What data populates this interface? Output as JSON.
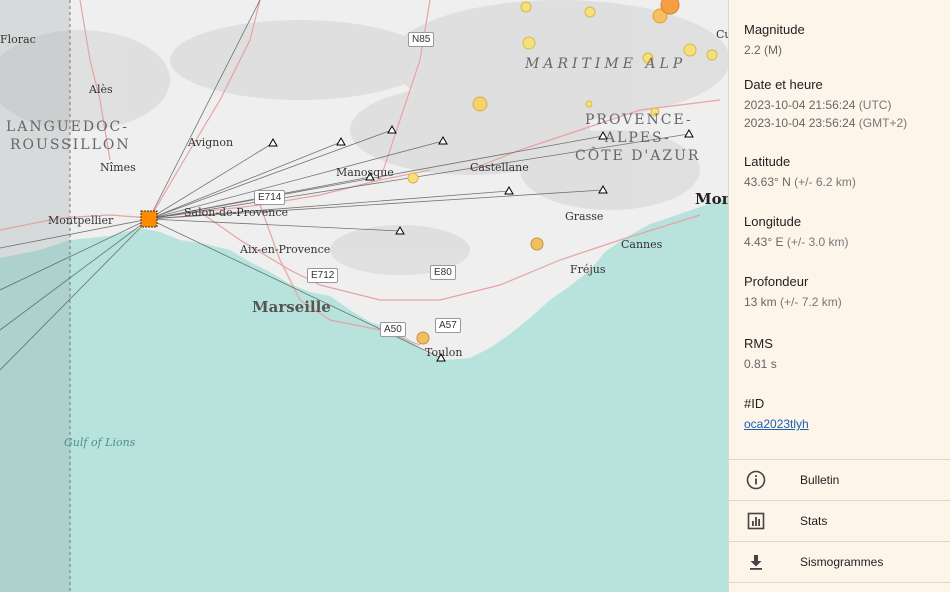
{
  "map": {
    "cities": [
      "Florac",
      "Alès",
      "Avignon",
      "Nîmes",
      "Montpellier",
      "Salon-de-Provence",
      "Aix-en-Provence",
      "Manosque",
      "Castellane",
      "Grasse",
      "Cannes",
      "Fréjus",
      "Toulon",
      "Mon",
      "Cu"
    ],
    "big_city": "Marseille",
    "regions": {
      "languedoc_1": "LANGUEDOC-",
      "languedoc_2": "ROUSSILLON",
      "maritime": "MARITIME ALP",
      "paca_1": "PROVENCE-",
      "paca_2": "ALPES-",
      "paca_3": "CÔTE D'AZUR"
    },
    "sea": "Gulf of Lions",
    "roads": [
      "N85",
      "E714",
      "E712",
      "E80",
      "A50",
      "A57"
    ],
    "colors": {
      "sea": "#b8e3dc",
      "land": "#efefef",
      "event": "#ff8c00",
      "station": "#000000",
      "ray": "#555555"
    }
  },
  "panel": {
    "magnitude_label": "Magnitude",
    "magnitude_value": "2.2 (M)",
    "date_label": "Date et heure",
    "date_utc": "2023-10-04 21:56:24",
    "date_utc_tz": "(UTC)",
    "date_local": "2023-10-04 23:56:24",
    "date_local_tz": "(GMT+2)",
    "latitude_label": "Latitude",
    "latitude_value": "43.63° N",
    "latitude_unc": "(+/- 6.2 km)",
    "longitude_label": "Longitude",
    "longitude_value": "4.43° E",
    "longitude_unc": "(+/- 3.0 km)",
    "depth_label": "Profondeur",
    "depth_value": "13 km",
    "depth_unc": "(+/- 7.2 km)",
    "rms_label": "RMS",
    "rms_value": "0.81 s",
    "id_label": "#ID",
    "id_value": "oca2023tlyh",
    "menu": {
      "bulletin": {
        "label": "Bulletin",
        "icon": "info-icon"
      },
      "stats": {
        "label": "Stats",
        "icon": "chart-icon"
      },
      "seismograms": {
        "label": "Sismogrammes",
        "icon": "download-icon"
      }
    }
  }
}
